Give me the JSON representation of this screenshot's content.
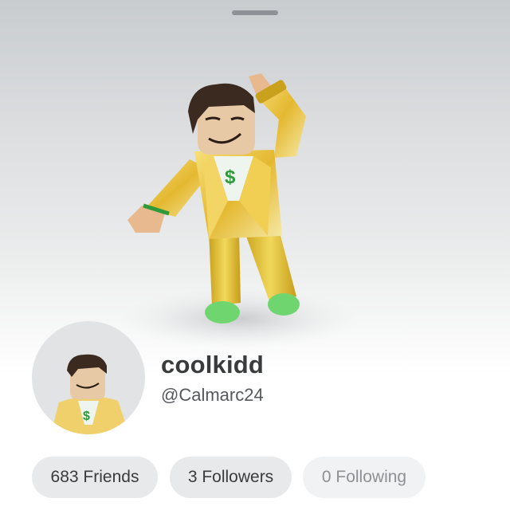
{
  "profile": {
    "display_name": "coolkidd",
    "username": "@Calmarc24"
  },
  "stats": [
    {
      "label": "683 Friends",
      "active": true
    },
    {
      "label": "3 Followers",
      "active": true
    },
    {
      "label": "0 Following",
      "active": false
    }
  ],
  "avatar": {
    "icon": "dollar-sign-icon",
    "outfit_color": "#e6c233",
    "shoe_color": "#6fd66f"
  }
}
